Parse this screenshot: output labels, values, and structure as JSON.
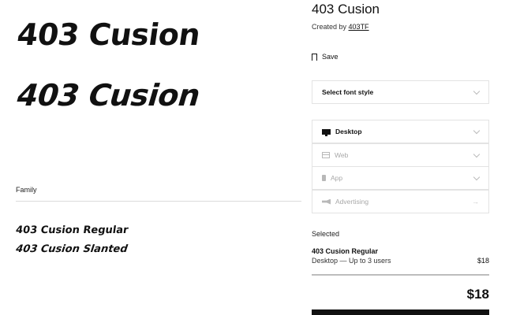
{
  "specimens": [
    "403 Cusion",
    "403 Cusion"
  ],
  "family": {
    "label": "Family",
    "styles": [
      "403 Cusion Regular",
      "403 Cusion Slanted"
    ]
  },
  "font": {
    "title": "403 Cusion",
    "created_by_prefix": "Created by",
    "author": "403TF"
  },
  "save_label": "Save",
  "font_style_select": "Select font style",
  "licenses": [
    {
      "label": "Desktop",
      "icon": "desktop-icon",
      "active": true
    },
    {
      "label": "Web",
      "icon": "web-icon",
      "active": false
    },
    {
      "label": "App",
      "icon": "app-icon",
      "active": false
    },
    {
      "label": "Advertising",
      "icon": "advertising-icon",
      "active": false
    }
  ],
  "selected": {
    "label": "Selected",
    "name": "403 Cusion Regular",
    "description": "Desktop — Up to 3 users",
    "price": "$18"
  },
  "total": "$18"
}
